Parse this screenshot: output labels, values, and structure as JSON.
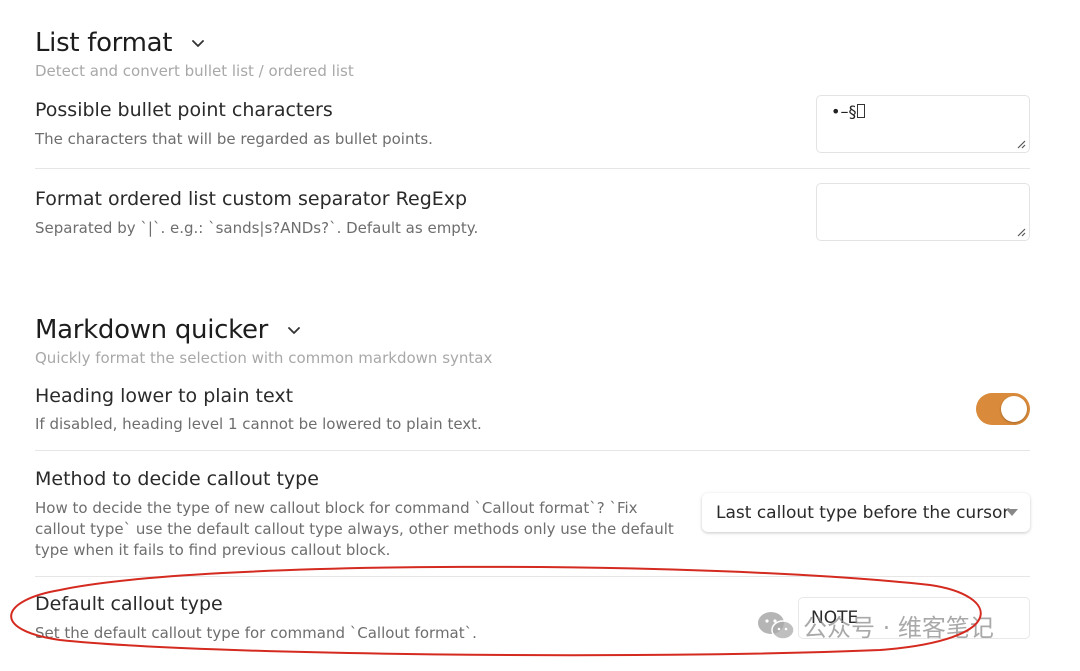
{
  "list_format": {
    "title": "List format",
    "description": "Detect and convert bullet list / ordered list",
    "bullet_chars": {
      "name": "Possible bullet point characters",
      "description": "The characters that will be regarded as bullet points.",
      "value": "•–§"
    },
    "ordered_separator": {
      "name": "Format ordered list custom separator RegExp",
      "description": "Separated by `|`. e.g.: `sands|s?ANDs?`. Default as empty.",
      "value": ""
    }
  },
  "markdown_quicker": {
    "title": "Markdown quicker",
    "description": "Quickly format the selection with common markdown syntax",
    "heading_lower": {
      "name": "Heading lower to plain text",
      "description": "If disabled, heading level 1 cannot be lowered to plain text.",
      "enabled": true
    },
    "callout_method": {
      "name": "Method to decide callout type",
      "description_line1": "How to decide the type of new callout block for command `Callout format`? `Fix",
      "description_line2": "callout type` use the default callout type always, other methods only use the default",
      "description_line3": "type when it fails to find previous callout block.",
      "selected": "Last callout type before the cursor"
    },
    "default_callout": {
      "name": "Default callout type",
      "description": "Set the default callout type for command `Callout format`.",
      "value": "NOTE"
    }
  },
  "watermark": {
    "text": "公众号 · 维客笔记"
  },
  "colors": {
    "accent": "#d98a3a",
    "annotation": "#d42a1f"
  }
}
